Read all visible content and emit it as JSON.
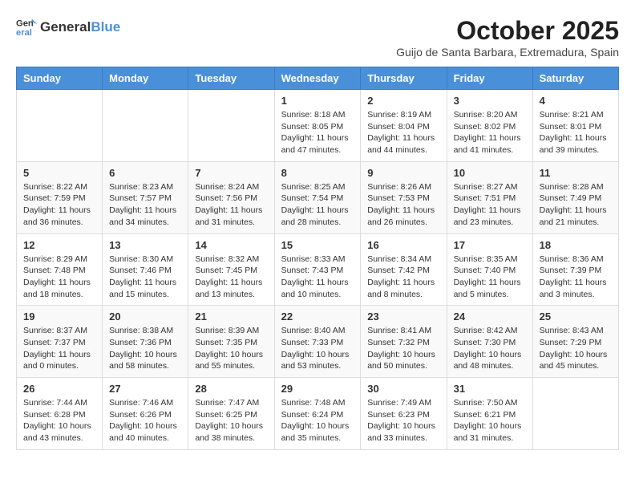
{
  "logo": {
    "general": "General",
    "blue": "Blue"
  },
  "title": "October 2025",
  "subtitle": "Guijo de Santa Barbara, Extremadura, Spain",
  "weekdays": [
    "Sunday",
    "Monday",
    "Tuesday",
    "Wednesday",
    "Thursday",
    "Friday",
    "Saturday"
  ],
  "weeks": [
    [
      {
        "day": "",
        "info": ""
      },
      {
        "day": "",
        "info": ""
      },
      {
        "day": "",
        "info": ""
      },
      {
        "day": "1",
        "info": "Sunrise: 8:18 AM\nSunset: 8:05 PM\nDaylight: 11 hours and 47 minutes."
      },
      {
        "day": "2",
        "info": "Sunrise: 8:19 AM\nSunset: 8:04 PM\nDaylight: 11 hours and 44 minutes."
      },
      {
        "day": "3",
        "info": "Sunrise: 8:20 AM\nSunset: 8:02 PM\nDaylight: 11 hours and 41 minutes."
      },
      {
        "day": "4",
        "info": "Sunrise: 8:21 AM\nSunset: 8:01 PM\nDaylight: 11 hours and 39 minutes."
      }
    ],
    [
      {
        "day": "5",
        "info": "Sunrise: 8:22 AM\nSunset: 7:59 PM\nDaylight: 11 hours and 36 minutes."
      },
      {
        "day": "6",
        "info": "Sunrise: 8:23 AM\nSunset: 7:57 PM\nDaylight: 11 hours and 34 minutes."
      },
      {
        "day": "7",
        "info": "Sunrise: 8:24 AM\nSunset: 7:56 PM\nDaylight: 11 hours and 31 minutes."
      },
      {
        "day": "8",
        "info": "Sunrise: 8:25 AM\nSunset: 7:54 PM\nDaylight: 11 hours and 28 minutes."
      },
      {
        "day": "9",
        "info": "Sunrise: 8:26 AM\nSunset: 7:53 PM\nDaylight: 11 hours and 26 minutes."
      },
      {
        "day": "10",
        "info": "Sunrise: 8:27 AM\nSunset: 7:51 PM\nDaylight: 11 hours and 23 minutes."
      },
      {
        "day": "11",
        "info": "Sunrise: 8:28 AM\nSunset: 7:49 PM\nDaylight: 11 hours and 21 minutes."
      }
    ],
    [
      {
        "day": "12",
        "info": "Sunrise: 8:29 AM\nSunset: 7:48 PM\nDaylight: 11 hours and 18 minutes."
      },
      {
        "day": "13",
        "info": "Sunrise: 8:30 AM\nSunset: 7:46 PM\nDaylight: 11 hours and 15 minutes."
      },
      {
        "day": "14",
        "info": "Sunrise: 8:32 AM\nSunset: 7:45 PM\nDaylight: 11 hours and 13 minutes."
      },
      {
        "day": "15",
        "info": "Sunrise: 8:33 AM\nSunset: 7:43 PM\nDaylight: 11 hours and 10 minutes."
      },
      {
        "day": "16",
        "info": "Sunrise: 8:34 AM\nSunset: 7:42 PM\nDaylight: 11 hours and 8 minutes."
      },
      {
        "day": "17",
        "info": "Sunrise: 8:35 AM\nSunset: 7:40 PM\nDaylight: 11 hours and 5 minutes."
      },
      {
        "day": "18",
        "info": "Sunrise: 8:36 AM\nSunset: 7:39 PM\nDaylight: 11 hours and 3 minutes."
      }
    ],
    [
      {
        "day": "19",
        "info": "Sunrise: 8:37 AM\nSunset: 7:37 PM\nDaylight: 11 hours and 0 minutes."
      },
      {
        "day": "20",
        "info": "Sunrise: 8:38 AM\nSunset: 7:36 PM\nDaylight: 10 hours and 58 minutes."
      },
      {
        "day": "21",
        "info": "Sunrise: 8:39 AM\nSunset: 7:35 PM\nDaylight: 10 hours and 55 minutes."
      },
      {
        "day": "22",
        "info": "Sunrise: 8:40 AM\nSunset: 7:33 PM\nDaylight: 10 hours and 53 minutes."
      },
      {
        "day": "23",
        "info": "Sunrise: 8:41 AM\nSunset: 7:32 PM\nDaylight: 10 hours and 50 minutes."
      },
      {
        "day": "24",
        "info": "Sunrise: 8:42 AM\nSunset: 7:30 PM\nDaylight: 10 hours and 48 minutes."
      },
      {
        "day": "25",
        "info": "Sunrise: 8:43 AM\nSunset: 7:29 PM\nDaylight: 10 hours and 45 minutes."
      }
    ],
    [
      {
        "day": "26",
        "info": "Sunrise: 7:44 AM\nSunset: 6:28 PM\nDaylight: 10 hours and 43 minutes."
      },
      {
        "day": "27",
        "info": "Sunrise: 7:46 AM\nSunset: 6:26 PM\nDaylight: 10 hours and 40 minutes."
      },
      {
        "day": "28",
        "info": "Sunrise: 7:47 AM\nSunset: 6:25 PM\nDaylight: 10 hours and 38 minutes."
      },
      {
        "day": "29",
        "info": "Sunrise: 7:48 AM\nSunset: 6:24 PM\nDaylight: 10 hours and 35 minutes."
      },
      {
        "day": "30",
        "info": "Sunrise: 7:49 AM\nSunset: 6:23 PM\nDaylight: 10 hours and 33 minutes."
      },
      {
        "day": "31",
        "info": "Sunrise: 7:50 AM\nSunset: 6:21 PM\nDaylight: 10 hours and 31 minutes."
      },
      {
        "day": "",
        "info": ""
      }
    ]
  ]
}
